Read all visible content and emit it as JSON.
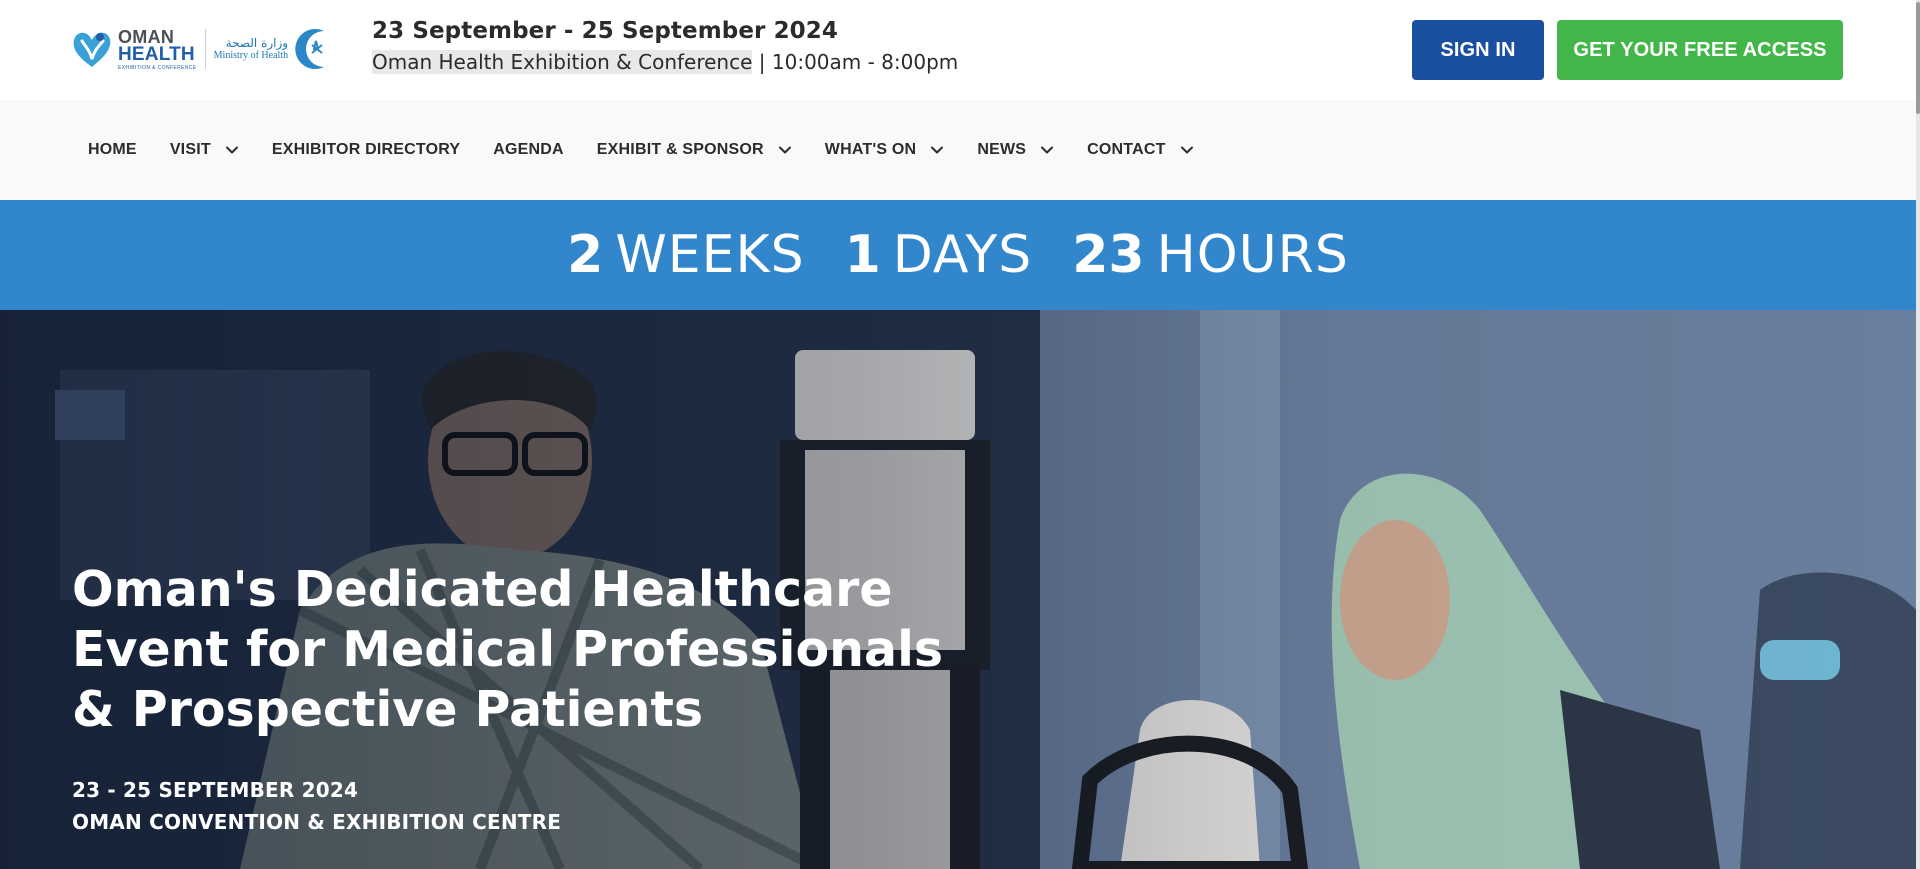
{
  "header": {
    "logo": {
      "brand_line1": "OMAN",
      "brand_line2": "HEALTH",
      "brand_tagline": "EXHIBITION & CONFERENCE",
      "ministry_arabic": "وزارة الصحة",
      "ministry_english": "Ministry of Health"
    },
    "event_dates": "23 September - 25 September 2024",
    "event_name": "Oman Health Exhibition & Conference",
    "event_separator": " | ",
    "event_hours": "10:00am - 8:00pm",
    "sign_in_label": "SIGN IN",
    "free_access_label": "GET YOUR FREE ACCESS",
    "colors": {
      "sign_in": "#1a4fa0",
      "free_access": "#43b649"
    }
  },
  "nav": {
    "items": [
      {
        "label": "HOME",
        "has_dropdown": false
      },
      {
        "label": "VISIT",
        "has_dropdown": true
      },
      {
        "label": "EXHIBITOR DIRECTORY",
        "has_dropdown": false
      },
      {
        "label": "AGENDA",
        "has_dropdown": false
      },
      {
        "label": "EXHIBIT & SPONSOR",
        "has_dropdown": true
      },
      {
        "label": "WHAT'S ON",
        "has_dropdown": true
      },
      {
        "label": "NEWS",
        "has_dropdown": true
      },
      {
        "label": "CONTACT",
        "has_dropdown": true
      }
    ],
    "dropdown_icon": "chevron-down-icon"
  },
  "countdown": {
    "weeks_value": "2",
    "weeks_label": "WEEKS",
    "days_value": "1",
    "days_label": "DAYS",
    "hours_value": "23",
    "hours_label": "HOURS",
    "background_color": "#3287cc"
  },
  "hero": {
    "title": "Oman's Dedicated Healthcare Event for Medical Professionals & Prospective Patients",
    "date": "23 - 25 SEPTEMBER 2024",
    "venue": "OMAN CONVENTION & EXHIBITION CENTRE"
  }
}
